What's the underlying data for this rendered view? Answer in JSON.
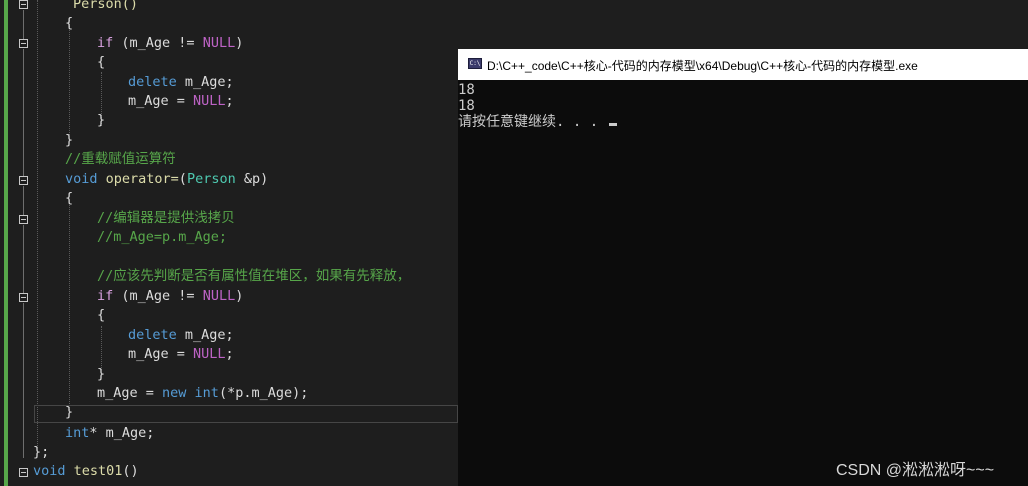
{
  "editor": {
    "lines": [
      {
        "text": "Person()"
      },
      {
        "text": "{"
      },
      {
        "kw": "if",
        "rest1": " (",
        "var": "m_Age",
        "rest2": " != ",
        "mac": "NULL",
        "rest3": ")"
      },
      {
        "text": "{"
      },
      {
        "kw": "delete",
        "rest1": " m_Age;"
      },
      {
        "rest1": "m_Age = ",
        "mac": "NULL",
        "rest3": ";"
      },
      {
        "text": "}"
      },
      {
        "text": "}"
      },
      {
        "comment": "//重载赋值运算符"
      },
      {
        "kw": "void",
        "fn": " operator=",
        "rest1": "(",
        "ty": "Person",
        "rest2": " &p)"
      },
      {
        "text": "{"
      },
      {
        "comment": "//编辑器是提供浅拷贝"
      },
      {
        "comment": "//m_Age=p.m_Age;"
      },
      {
        "comment": "//应该先判断是否有属性值在堆区，如果有先释放，"
      },
      {
        "kw": "if",
        "rest1": " (",
        "var": "m_Age",
        "rest2": " != ",
        "mac": "NULL",
        "rest3": ")"
      },
      {
        "text": "{"
      },
      {
        "kw": "delete",
        "rest1": " m_Age;"
      },
      {
        "rest1": "m_Age = ",
        "mac": "NULL",
        "rest3": ";"
      },
      {
        "text": "}"
      },
      {
        "pre": "m_Age = ",
        "kw": "new",
        "kw2": " int",
        "rest1": "(*p.m_Age);"
      },
      {
        "text": "}"
      },
      {
        "kw": "int",
        "rest1": "* m_Age;"
      },
      {
        "text": "};"
      },
      {
        "kw": "void",
        "fn": " test01",
        "rest1": "()"
      }
    ]
  },
  "console": {
    "title": "D:\\C++_code\\C++核心-代码的内存模型\\x64\\Debug\\C++核心-代码的内存模型.exe",
    "icon_label": "C:\\",
    "output": [
      "18",
      "18",
      "请按任意键继续. . . "
    ]
  },
  "watermark": "CSDN @淞淞淞呀~~~",
  "colors": {
    "keyword": "#569cd6",
    "control": "#d8a0df",
    "macro": "#bd63c5",
    "type": "#4ec9b0",
    "function": "#dcdcaa",
    "comment": "#57a64a",
    "text": "#dcdcdc",
    "background": "#1e1e1e",
    "console_bg": "#0c0c0c"
  }
}
